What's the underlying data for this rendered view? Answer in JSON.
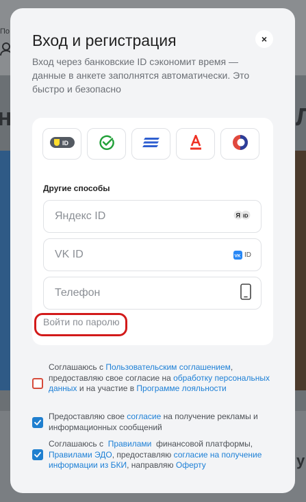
{
  "background": {
    "snippet_left": "По",
    "big_left": "но",
    "big_right": "Л",
    "snippet_right": "у"
  },
  "modal": {
    "title": "Вход и регистрация",
    "close_label": "×",
    "subtitle": "Вход через банковские ID сэкономит время — данные в анкете заполнятся автоматически. Это быстро и безопасно"
  },
  "bank_ids": [
    {
      "icon": "tinkoff-id-icon",
      "badge_text": "ID"
    },
    {
      "icon": "sber-id-icon"
    },
    {
      "icon": "vtb-id-icon"
    },
    {
      "icon": "alfa-id-icon"
    },
    {
      "icon": "gazprombank-id-icon"
    }
  ],
  "other_methods": {
    "label": "Другие способы",
    "yandex": {
      "text": "Яндекс ID",
      "badge": "ЯID"
    },
    "vk": {
      "text": "VK ID",
      "badge": "ID"
    },
    "phone": {
      "text": "Телефон"
    }
  },
  "password_link": "Войти по паролю",
  "consents": [
    {
      "checked": false,
      "parts": [
        "Соглашаюсь с ",
        "Пользовательским соглашением",
        ", предоставляю свое согласие на ",
        "обработку персональных данных",
        " и на участие в ",
        "Программе лояльности"
      ]
    },
    {
      "checked": true,
      "parts": [
        "Предоставляю свое ",
        "согласие",
        " на получение рекламы и информационных сообщений"
      ]
    },
    {
      "checked": true,
      "parts": [
        "Соглашаюсь с  ",
        "Правилами",
        "  финансовой платформы, ",
        "Правилами ЭДО",
        ", предоставляю ",
        "согласие на получение информации из БКИ",
        ", направляю ",
        "Оферту"
      ]
    }
  ],
  "colors": {
    "accent": "#1c7fd6",
    "checkbox": "#1f7fcf",
    "highlight": "#d21a1a",
    "error_checkbox": "#d64b3b"
  }
}
